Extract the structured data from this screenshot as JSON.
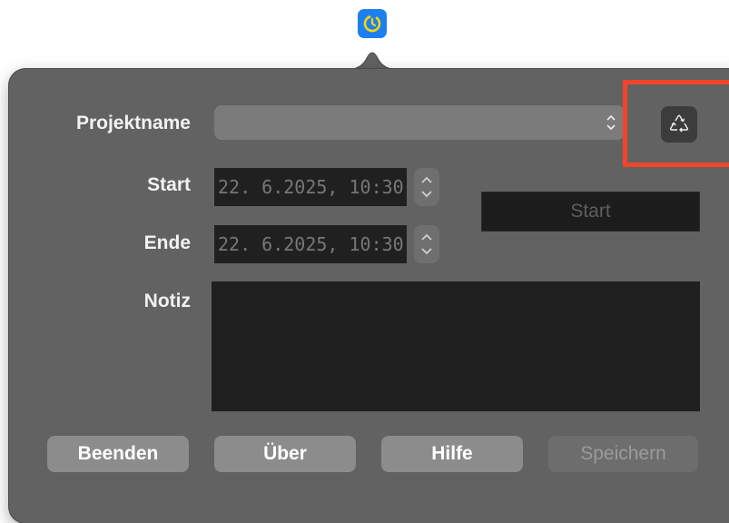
{
  "menubar": {
    "icon": "timer-icon",
    "accent": "#1e7ff0"
  },
  "form": {
    "project_label": "Projektname",
    "project_value": "",
    "start_label": "Start",
    "start_value": "22. 6.2025, 10:30",
    "end_label": "Ende",
    "end_value": "22. 6.2025, 10:30",
    "note_label": "Notiz",
    "note_value": "",
    "start_button": "Start",
    "recycle_icon": "recycle-icon"
  },
  "buttons": {
    "quit": "Beenden",
    "about": "Über",
    "help": "Hilfe",
    "save": "Speichern"
  },
  "highlight_color": "#f0452b"
}
